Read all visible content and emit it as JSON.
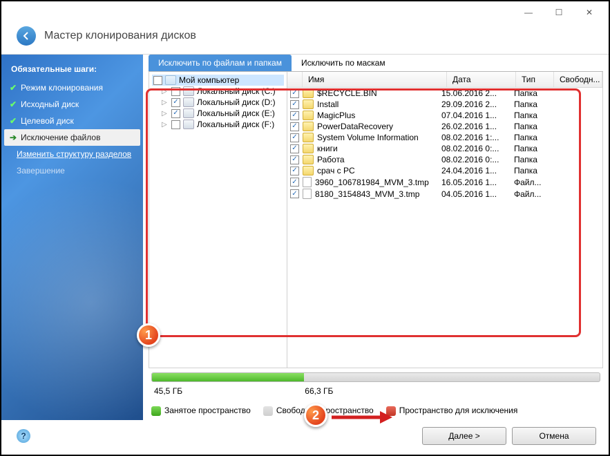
{
  "window": {
    "minimize": "—",
    "maximize": "☐",
    "close": "✕"
  },
  "header": {
    "title": "Мастер клонирования дисков"
  },
  "sidebar": {
    "heading": "Обязательные шаги:",
    "items": [
      {
        "label": "Режим клонирования",
        "done": true
      },
      {
        "label": "Исходный диск",
        "done": true
      },
      {
        "label": "Целевой диск",
        "done": true
      },
      {
        "label": "Исключение файлов",
        "active": true
      },
      {
        "label": "Изменить структуру разделов",
        "link": true
      },
      {
        "label": "Завершение",
        "dim": true
      }
    ]
  },
  "tabs": {
    "files": "Исключить по файлам и папкам",
    "masks": "Исключить по маскам"
  },
  "tree": {
    "root": "Мой компьютер",
    "drives": [
      {
        "label": "Локальный диск (C:)",
        "checked": false
      },
      {
        "label": "Локальный диск (D:)",
        "checked": true
      },
      {
        "label": "Локальный диск (E:)",
        "checked": true
      },
      {
        "label": "Локальный диск (F:)",
        "checked": false
      }
    ]
  },
  "columns": {
    "name": "Имя",
    "date": "Дата",
    "type": "Тип",
    "free": "Свободн..."
  },
  "files": [
    {
      "name": "$RECYCLE.BIN",
      "date": "15.06.2016 2...",
      "type": "Папка",
      "icon": "folder",
      "checked": true
    },
    {
      "name": "Install",
      "date": "29.09.2016 2...",
      "type": "Папка",
      "icon": "folder",
      "checked": true
    },
    {
      "name": "MagicPlus",
      "date": "07.04.2016 1...",
      "type": "Папка",
      "icon": "folder",
      "checked": true
    },
    {
      "name": "PowerDataRecovery",
      "date": "26.02.2016 1...",
      "type": "Папка",
      "icon": "folder",
      "checked": true
    },
    {
      "name": "System Volume Information",
      "date": "08.02.2016 1:...",
      "type": "Папка",
      "icon": "folder",
      "checked": true
    },
    {
      "name": "книги",
      "date": "08.02.2016 0:...",
      "type": "Папка",
      "icon": "folder",
      "checked": true
    },
    {
      "name": "Работа",
      "date": "08.02.2016 0:...",
      "type": "Папка",
      "icon": "folder",
      "checked": true
    },
    {
      "name": "срач с PC",
      "date": "24.04.2016 1...",
      "type": "Папка",
      "icon": "folder",
      "checked": true
    },
    {
      "name": "3960_106781984_MVM_3.tmp",
      "date": "16.05.2016 1...",
      "type": "Файл...",
      "icon": "file",
      "checked": true
    },
    {
      "name": "8180_3154843_MVM_3.tmp",
      "date": "04.05.2016 1...",
      "type": "Файл...",
      "icon": "file",
      "checked": true
    }
  ],
  "space": {
    "used_pct": 34,
    "used_label": "45,5 ГБ",
    "total_label": "66,3 ГБ"
  },
  "legend": {
    "used": "Занятое пространство",
    "free": "Свободное пространство",
    "excl": "Пространство для исключения"
  },
  "footer": {
    "next": "Далее >",
    "cancel": "Отмена"
  },
  "markers": {
    "one": "1",
    "two": "2"
  }
}
